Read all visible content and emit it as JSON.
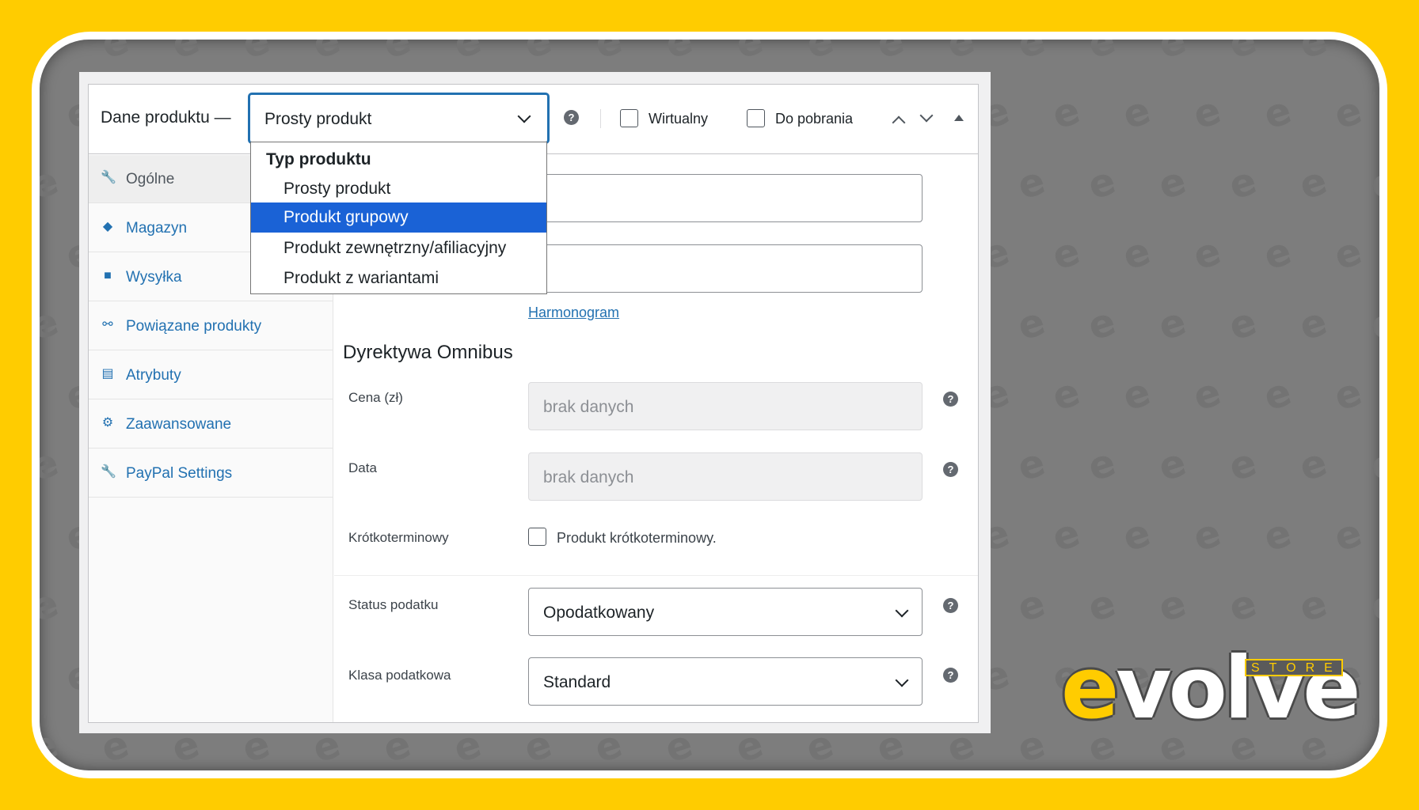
{
  "header": {
    "title": "Dane produktu —",
    "product_type_value": "Prosty produkt",
    "virtual_label": "Wirtualny",
    "downloadable_label": "Do pobrania"
  },
  "dropdown": {
    "group_label": "Typ produktu",
    "options": [
      {
        "label": "Prosty produkt",
        "selected": false
      },
      {
        "label": "Produkt grupowy",
        "selected": true
      },
      {
        "label": "Produkt zewnętrzny/afiliacyjny",
        "selected": false
      },
      {
        "label": "Produkt z wariantami",
        "selected": false
      }
    ]
  },
  "sidebar": {
    "items": [
      {
        "label": "Ogólne",
        "icon": "wrench-icon",
        "active": true
      },
      {
        "label": "Magazyn",
        "icon": "tag-icon",
        "active": false
      },
      {
        "label": "Wysyłka",
        "icon": "truck-icon",
        "active": false
      },
      {
        "label": "Powiązane produkty",
        "icon": "link-icon",
        "active": false
      },
      {
        "label": "Atrybuty",
        "icon": "list-icon",
        "active": false
      },
      {
        "label": "Zaawansowane",
        "icon": "gear-icon",
        "active": false
      },
      {
        "label": "PayPal Settings",
        "icon": "wrench-icon",
        "active": false
      }
    ]
  },
  "content": {
    "schedule_link": "Harmonogram",
    "omnibus_title": "Dyrektywa Omnibus",
    "price_label": "Cena (zł)",
    "price_value": "brak danych",
    "date_label": "Data",
    "date_value": "brak danych",
    "short_term_label": "Krótkoterminowy",
    "short_term_checkbox_label": "Produkt krótkoterminowy.",
    "tax_status_label": "Status podatku",
    "tax_status_value": "Opodatkowany",
    "tax_class_label": "Klasa podatkowa",
    "tax_class_value": "Standard"
  },
  "logo": {
    "text": "evolve",
    "store": "STORE"
  },
  "colors": {
    "background": "#FFCC00",
    "accent": "#2271b1",
    "selected_option": "#1a62d6"
  }
}
